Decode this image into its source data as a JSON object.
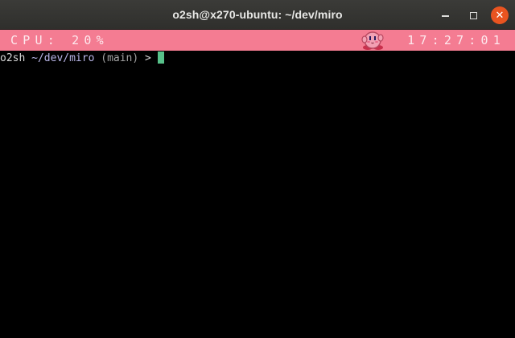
{
  "window": {
    "title": "o2sh@x270-ubuntu: ~/dev/miro",
    "controls": {
      "minimize_icon": "minimize-icon",
      "maximize_icon": "maximize-icon",
      "close_icon": "close-icon",
      "close_color": "#e95420"
    }
  },
  "statusbar": {
    "cpu_label": "CPU: 20%",
    "clock": "17:27:01",
    "mascot_icon": "kirby-mascot-icon",
    "background_color": "#f47c92"
  },
  "terminal": {
    "prompt": {
      "user": "o2sh",
      "path": "~/dev/miro",
      "branch": "(main)",
      "symbol": ">"
    },
    "cursor_color": "#58c18a"
  }
}
